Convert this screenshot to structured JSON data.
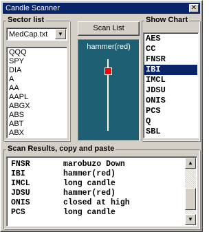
{
  "window": {
    "title": "Candle Scanner",
    "close_glyph": "✕"
  },
  "sector": {
    "label": "Sector list",
    "dropdown_value": "MedCap.txt",
    "symbols": [
      "QQQ",
      "SPY",
      "DIA",
      "A",
      "AA",
      "AAPL",
      "ABGX",
      "ABS",
      "ABT",
      "ABX"
    ]
  },
  "scan": {
    "button_label": "Scan List",
    "pattern_label": "hammer(red)",
    "candle_color": "#ff0000",
    "bg_color": "#1f5f73"
  },
  "show_chart": {
    "label": "Show Chart",
    "items": [
      "AES",
      "CC",
      "FNSR",
      "IBI",
      "IMCL",
      "JDSU",
      "ONIS",
      "PCS",
      "Q",
      "SBL"
    ],
    "selected_index": 3
  },
  "results": {
    "label": "Scan Results, copy and paste",
    "rows": [
      {
        "symbol": "FNSR",
        "pattern": "marobuzo Down"
      },
      {
        "symbol": "IBI",
        "pattern": "hammer(red)"
      },
      {
        "symbol": "IMCL",
        "pattern": "long candle"
      },
      {
        "symbol": "JDSU",
        "pattern": "hammer(red)"
      },
      {
        "symbol": "ONIS",
        "pattern": "closed at high"
      },
      {
        "symbol": "PCS",
        "pattern": "long candle"
      }
    ]
  },
  "icons": {
    "up_arrow": "▲",
    "down_arrow": "▼"
  }
}
